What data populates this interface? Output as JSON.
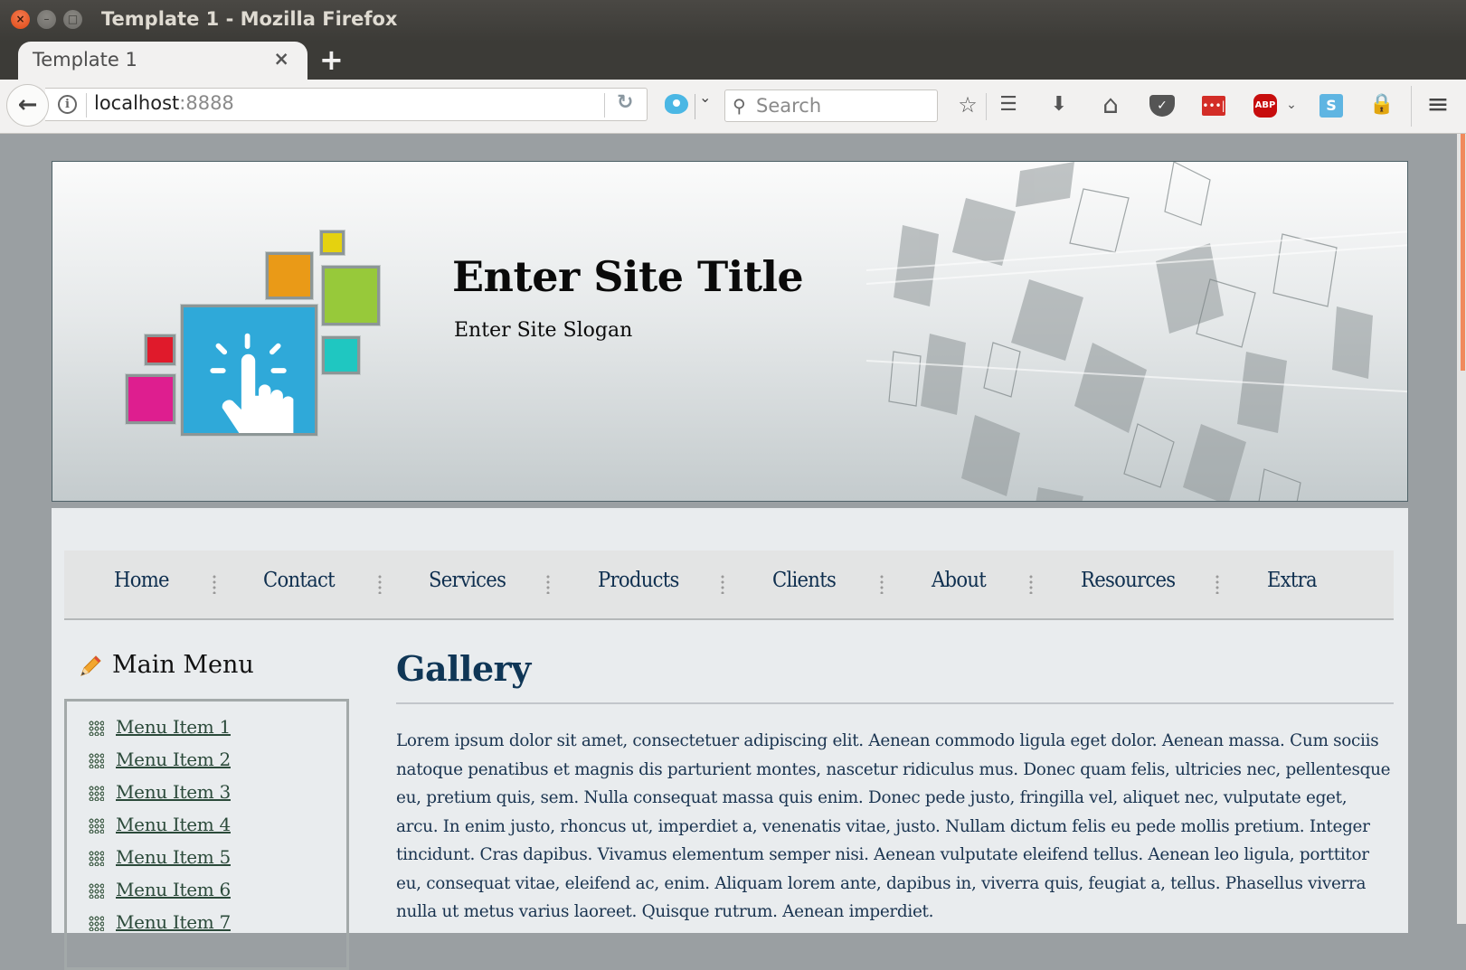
{
  "window": {
    "title": "Template 1 - Mozilla Firefox",
    "controls": {
      "close": "×",
      "minimize": "–",
      "maximize": "□"
    }
  },
  "browser": {
    "tab_label": "Template 1",
    "tab_close": "×",
    "new_tab": "+",
    "back_icon": "←",
    "url_host": "localhost",
    "url_port": ":8888",
    "reload_icon": "↻",
    "search_placeholder": "Search",
    "search_icon": "⚲",
    "engine_dropdown": "⌄",
    "toolbar_icons": [
      {
        "name": "bookmark-star-icon",
        "glyph": "☆"
      },
      {
        "name": "reading-list-icon",
        "glyph": "☰"
      },
      {
        "name": "download-icon",
        "glyph": "🡇"
      },
      {
        "name": "home-icon",
        "glyph": "⌂"
      },
      {
        "name": "pocket-icon",
        "glyph": "⌄"
      },
      {
        "name": "lastpass-icon",
        "glyph": "•••|"
      },
      {
        "name": "adblock-plus-icon",
        "glyph": "ABP"
      },
      {
        "name": "skype-icon",
        "glyph": "S"
      },
      {
        "name": "lock-extension-icon",
        "glyph": "🔒"
      },
      {
        "name": "hamburger-menu-icon",
        "glyph": "≡"
      }
    ],
    "abp_dropdown": "⌄"
  },
  "site": {
    "title": "Enter Site Title",
    "slogan": "Enter Site Slogan",
    "logo_colors": {
      "blue": "#2fa9d9",
      "orange": "#ea9a17",
      "yellow": "#e5d20f",
      "green": "#97c93a",
      "teal": "#1fc7c1",
      "red": "#e01a2b",
      "magenta": "#de1e8f"
    }
  },
  "nav": {
    "items": [
      "Home",
      "Contact",
      "Services",
      "Products",
      "Clients",
      "About",
      "Resources",
      "Extra"
    ]
  },
  "sidebar": {
    "title": "Main Menu",
    "items": [
      "Menu Item 1",
      "Menu Item 2",
      "Menu Item 3",
      "Menu Item 4",
      "Menu Item 5",
      "Menu Item 6",
      "Menu Item 7"
    ]
  },
  "main": {
    "title": "Gallery",
    "paragraph": "Lorem ipsum dolor sit amet, consectetuer adipiscing elit. Aenean commodo ligula eget dolor. Aenean massa. Cum sociis natoque penatibus et magnis dis parturient montes, nascetur ridiculus mus. Donec quam felis, ultricies nec, pellentesque eu, pretium quis, sem. Nulla consequat massa quis enim. Donec pede justo, fringilla vel, aliquet nec, vulputate eget, arcu. In enim justo, rhoncus ut, imperdiet a, venenatis vitae, justo. Nullam dictum felis eu pede mollis pretium. Integer tincidunt. Cras dapibus. Vivamus elementum semper nisi. Aenean vulputate eleifend tellus. Aenean leo ligula, porttitor eu, consequat vitae, eleifend ac, enim. Aliquam lorem ante, dapibus in, viverra quis, feugiat a, tellus. Phasellus viverra nulla ut metus varius laoreet. Quisque rutrum. Aenean imperdiet."
  },
  "colors": {
    "nav_text": "#0f2f4f",
    "heading": "#0f3656",
    "link": "#2b4a3a",
    "scroll_thumb": "#f08a5d"
  }
}
